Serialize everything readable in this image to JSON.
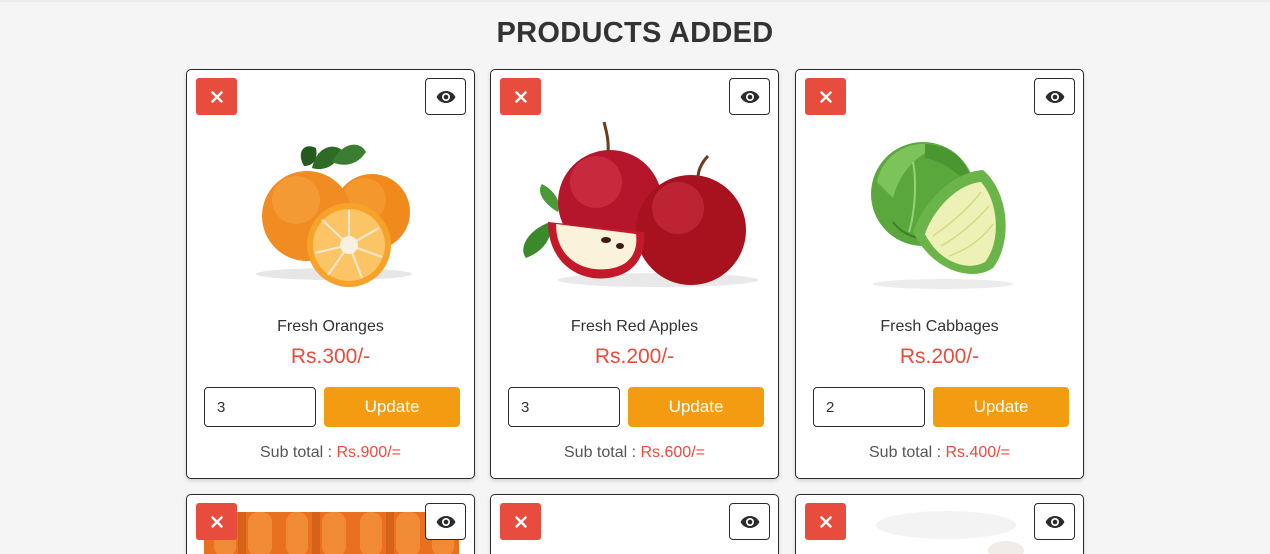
{
  "page": {
    "title": "PRODUCTS ADDED"
  },
  "colors": {
    "accent_red": "#e74c3c",
    "accent_orange": "#f39c12",
    "text_dark": "#333333"
  },
  "icons": {
    "delete": "close-icon",
    "view": "eye-icon"
  },
  "products": [
    {
      "name": "Fresh Oranges",
      "price": "Rs.300/-",
      "quantity": "3",
      "update_label": "Update",
      "subtotal_label": "Sub total : ",
      "subtotal_value": "Rs.900/="
    },
    {
      "name": "Fresh Red Apples",
      "price": "Rs.200/-",
      "quantity": "3",
      "update_label": "Update",
      "subtotal_label": "Sub total : ",
      "subtotal_value": "Rs.600/="
    },
    {
      "name": "Fresh Cabbages",
      "price": "Rs.200/-",
      "quantity": "2",
      "update_label": "Update",
      "subtotal_label": "Sub total : ",
      "subtotal_value": "Rs.400/="
    }
  ]
}
